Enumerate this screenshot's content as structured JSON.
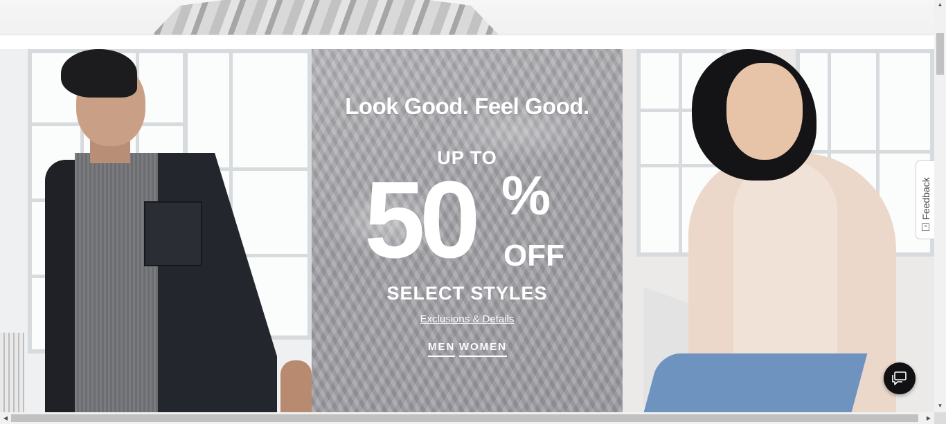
{
  "promo": {
    "headline": "Look Good. Feel Good.",
    "up_to": "UP TO",
    "amount": "50",
    "percent": "%",
    "off": "OFF",
    "select_styles": "SELECT STYLES",
    "exclusions_link": "Exclusions & Details",
    "cta_men": "MEN",
    "cta_women": "WOMEN"
  },
  "feedback": {
    "label": "Feedback"
  },
  "chat": {
    "icon": "chat-bubble-icon"
  },
  "scrollbars": {
    "up": "▲",
    "down": "▼",
    "left": "◀",
    "right": "▶"
  },
  "colors": {
    "promo_text": "#ffffff",
    "chat_bg": "#111113"
  }
}
